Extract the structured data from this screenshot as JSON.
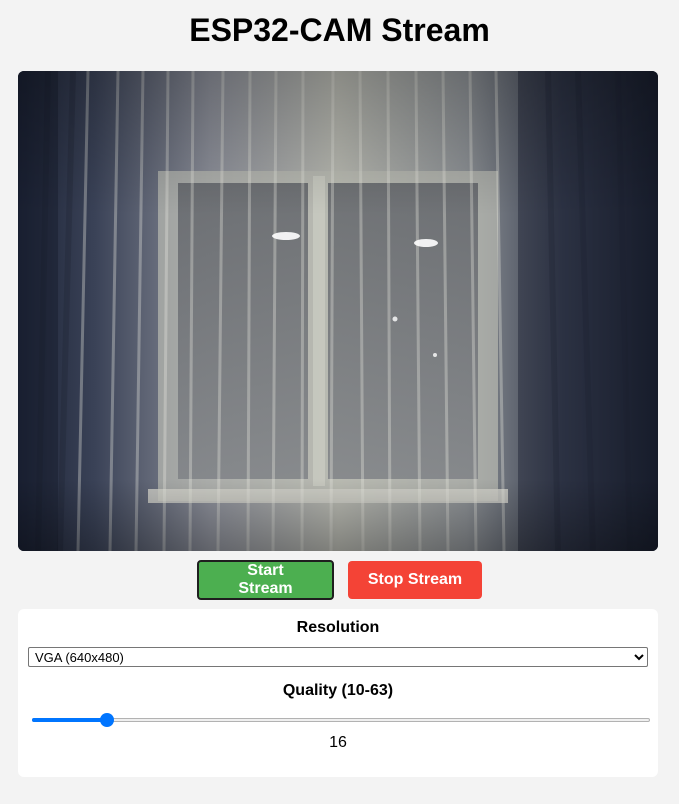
{
  "page": {
    "title": "ESP32-CAM Stream"
  },
  "stream": {
    "image_description_icon": "camera-frame-curtains"
  },
  "buttons": {
    "start_label": "Start Stream",
    "stop_label": "Stop Stream",
    "start_color": "#4caf50",
    "stop_color": "#f44336"
  },
  "controls": {
    "resolution_label": "Resolution",
    "resolution_selected": "VGA (640x480)",
    "quality_label": "Quality (10-63)",
    "quality_min": 10,
    "quality_max": 63,
    "quality_value": "16"
  }
}
